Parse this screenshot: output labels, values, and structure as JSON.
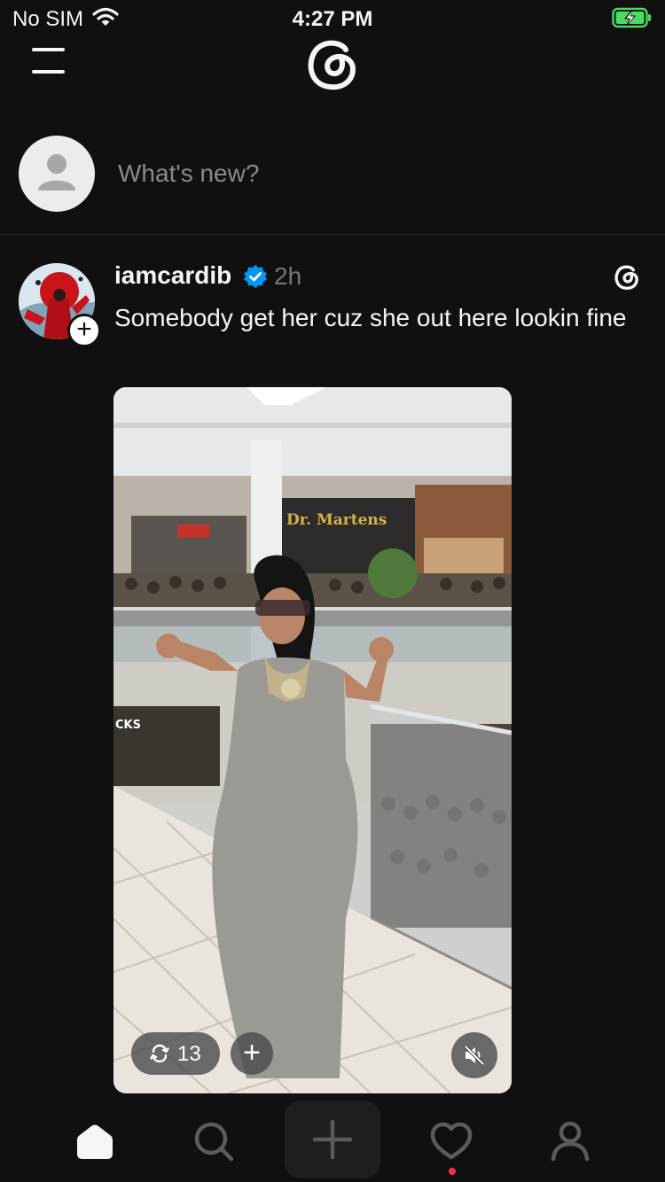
{
  "status_bar": {
    "carrier": "No SIM",
    "time": "4:27 PM",
    "wifi_icon": "wifi-icon",
    "battery_icon": "battery-charging-icon",
    "battery_color": "#4cd964"
  },
  "header": {
    "menu_icon": "hamburger-menu-icon",
    "logo_icon": "threads-logo-icon"
  },
  "composer": {
    "placeholder": "What's new?",
    "avatar_icon": "default-avatar-icon"
  },
  "post": {
    "username": "iamcardib",
    "verified_icon": "verified-badge-icon",
    "verified_color": "#0095f6",
    "timestamp": "2h",
    "text": "Somebody get her cuz she out here lookin fine",
    "media": {
      "type": "video",
      "repost_count": "13",
      "repost_icon": "repost-icon",
      "add_icon": "plus-icon",
      "mute_icon": "muted-speaker-icon",
      "in_image_text": [
        "Dr. Martens",
        "CKS"
      ]
    }
  },
  "tabbar": {
    "items": [
      "home-icon",
      "search-icon",
      "new-thread-icon",
      "activity-heart-icon",
      "profile-icon"
    ],
    "active": "home-icon",
    "notification_dot_color": "#ff3040"
  }
}
